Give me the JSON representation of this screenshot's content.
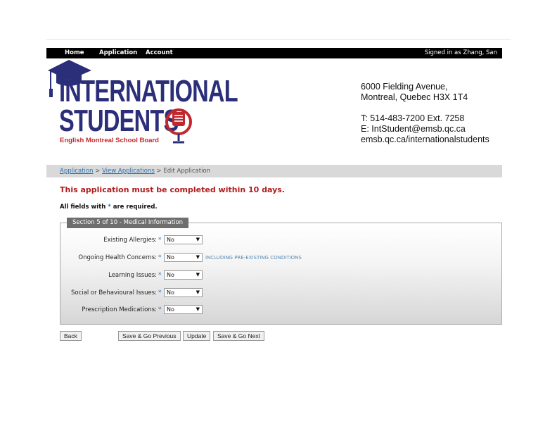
{
  "nav": {
    "items": [
      "Home",
      "Application",
      "Account"
    ],
    "signed_in": "Signed in as Zhang, San"
  },
  "logo": {
    "line1": "INTERNATIONAL",
    "line2": "STUDENTS",
    "subtitle": "English Montreal School Board"
  },
  "contact": {
    "address1": "6000 Fielding Avenue,",
    "address2": "Montreal, Quebec H3X 1T4",
    "phone": "T: 514-483-7200 Ext. 7258",
    "email": "E: IntStudent@emsb.qc.ca",
    "website": "emsb.qc.ca/internationalstudents"
  },
  "breadcrumb": {
    "link1": "Application",
    "sep": ">",
    "link2": "View Applications",
    "current": "Edit Application"
  },
  "warning": "This application must be completed within 10 days.",
  "required_note": {
    "prefix": "All fields with",
    "star": "*",
    "suffix": "are required."
  },
  "section": {
    "legend": "Section 5 of 10 - Medical Information",
    "fields": [
      {
        "label": "Existing Allergies:",
        "value": "No",
        "hint": ""
      },
      {
        "label": "Ongoing Health Concerns:",
        "value": "No",
        "hint": "INCLUDING PRE-EXISTING CONDITIONS"
      },
      {
        "label": "Learning Issues:",
        "value": "No",
        "hint": ""
      },
      {
        "label": "Social or Behavioural Issues:",
        "value": "No",
        "hint": ""
      },
      {
        "label": "Prescription Medications:",
        "value": "No",
        "hint": ""
      }
    ]
  },
  "buttons": {
    "back": "Back",
    "save_previous": "Save & Go Previous",
    "update": "Update",
    "save_next": "Save & Go Next"
  },
  "colors": {
    "brand_navy": "#2b2e78",
    "brand_red": "#c0282d",
    "warning_red": "#b01c1c",
    "link_blue": "#2a6fb0"
  }
}
